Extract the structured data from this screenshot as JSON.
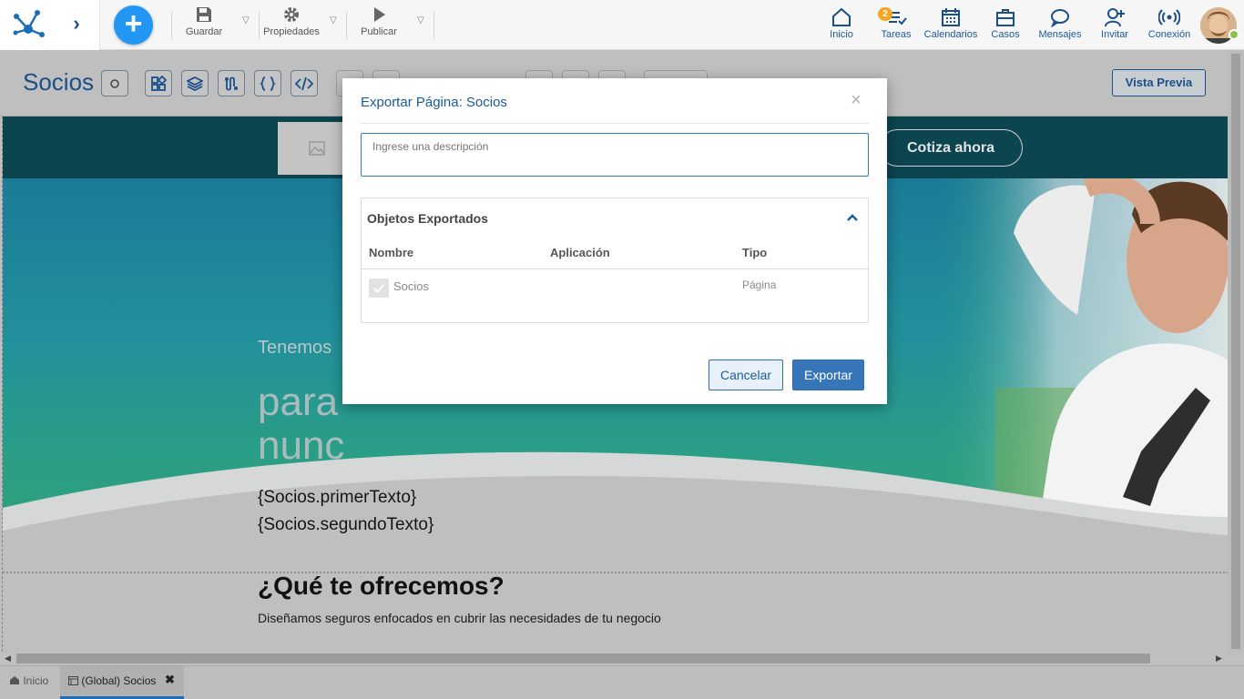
{
  "topbar": {
    "tools": {
      "save_label": "Guardar",
      "properties_label": "Propiedades",
      "publish_label": "Publicar"
    },
    "nav": {
      "home": "Inicio",
      "tasks": "Tareas",
      "tasks_badge": "2",
      "calendars": "Calendarios",
      "cases": "Casos",
      "messages": "Mensajes",
      "invite": "Invitar",
      "connection": "Conexión"
    }
  },
  "subbar": {
    "page_title": "Socios",
    "preview_label": "Vista Previa"
  },
  "canvas": {
    "cta_label": "Cotiza ahora",
    "hero_line1": "Tenemos",
    "hero_line2a": "para",
    "hero_line2b": "nunc",
    "placeholder1": "{Socios.primerTexto}",
    "placeholder2": "{Socios.segundoTexto}",
    "section_title": "¿Qué te ofrecemos?",
    "section_sub": "Diseñamos seguros enfocados en cubrir las necesidades de tu negocio"
  },
  "tabs": {
    "home": "Inicio",
    "active": "(Global) Socios"
  },
  "modal": {
    "title": "Exportar Página: Socios",
    "close": "×",
    "description_placeholder": "Ingrese una descripción",
    "panel_title": "Objetos Exportados",
    "columns": [
      "Nombre",
      "Aplicación",
      "Tipo"
    ],
    "rows": [
      {
        "name": "Socios",
        "application": "",
        "type": "Página",
        "checked": true
      }
    ],
    "cancel_label": "Cancelar",
    "export_label": "Exportar"
  },
  "colors": {
    "brand_blue": "#1b4f8a",
    "accent_blue": "#2196f3",
    "primary_button": "#3676b8",
    "badge": "#f5a623",
    "online": "#8bc34a"
  }
}
